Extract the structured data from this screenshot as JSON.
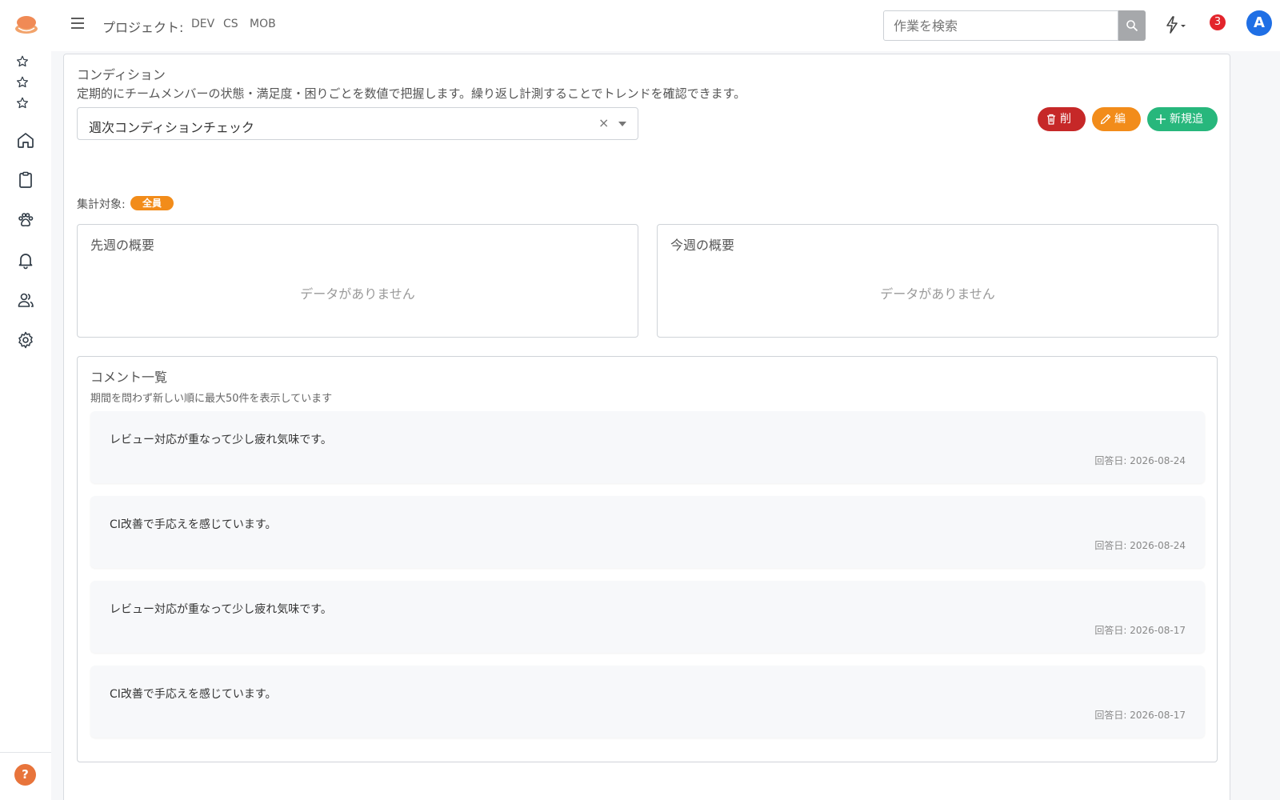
{
  "header": {
    "project_label": "プロジェクト:",
    "projects": [
      "DEV",
      "CS",
      "MOB"
    ],
    "search_placeholder": "作業を検索",
    "notification_count": "3",
    "avatar_initial": "A"
  },
  "sidebar": {
    "icons": [
      "star-icon",
      "star-icon",
      "star-icon",
      "home-icon",
      "clipboard-icon",
      "paw-icon",
      "bell-icon",
      "users-icon",
      "gear-icon"
    ],
    "help_label": "?"
  },
  "page": {
    "title": "コンディション",
    "description": "定期的にチームメンバーの状態・満足度・困りごとを数値で把握します。繰り返し計測することでトレンドを確認できます。",
    "selected_survey": "週次コンディションチェック",
    "clear_symbol": "×",
    "buttons": {
      "delete": "削除",
      "edit": "編集",
      "add": "新規追加"
    },
    "target_label": "集計対象:",
    "target_value": "全員"
  },
  "summaries": {
    "last_week_title": "先週の概要",
    "this_week_title": "今週の概要",
    "empty_text": "データがありません"
  },
  "comments": {
    "title": "コメント一覧",
    "subtitle": "期間を問わず新しい順に最大50件を表示しています",
    "items": [
      {
        "text": "レビュー対応が重なって少し疲れ気味です。",
        "date": "回答日: 2026-08-24"
      },
      {
        "text": "CI改善で手応えを感じています。",
        "date": "回答日: 2026-08-24"
      },
      {
        "text": "レビュー対応が重なって少し疲れ気味です。",
        "date": "回答日: 2026-08-17"
      },
      {
        "text": "CI改善で手応えを感じています。",
        "date": "回答日: 2026-08-17"
      }
    ]
  },
  "colors": {
    "delete": "#c62828",
    "edit": "#f28c1a",
    "add": "#27b77c",
    "badge": "#f28c1a",
    "avatar": "#1f6fe5",
    "notification": "#e3242b",
    "help": "#e8743b"
  }
}
